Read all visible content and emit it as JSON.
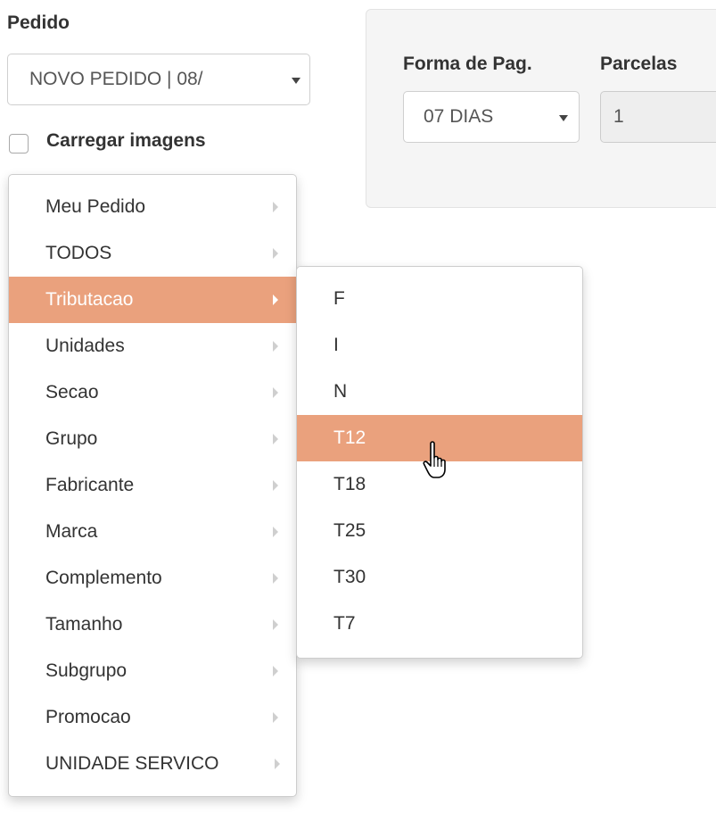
{
  "form": {
    "pedido_label": "Pedido",
    "pedido_value": "NOVO PEDIDO | 08/",
    "load_images_label": "Carregar imagens",
    "load_images_checked": false
  },
  "payment": {
    "forma_label": "Forma de Pag.",
    "forma_value": "07 DIAS",
    "parcelas_label": "Parcelas",
    "parcelas_value": "1"
  },
  "menu": {
    "items": [
      {
        "label": "Meu Pedido"
      },
      {
        "label": "TODOS"
      },
      {
        "label": "Tributacao",
        "active": true
      },
      {
        "label": "Unidades"
      },
      {
        "label": "Secao"
      },
      {
        "label": "Grupo"
      },
      {
        "label": "Fabricante"
      },
      {
        "label": "Marca"
      },
      {
        "label": "Complemento"
      },
      {
        "label": "Tamanho"
      },
      {
        "label": "Subgrupo"
      },
      {
        "label": "Promocao"
      },
      {
        "label": "UNIDADE SERVICO"
      }
    ]
  },
  "submenu": {
    "items": [
      {
        "label": "F"
      },
      {
        "label": "I"
      },
      {
        "label": "N"
      },
      {
        "label": "T12",
        "active": true
      },
      {
        "label": "T18"
      },
      {
        "label": "T25"
      },
      {
        "label": "T30"
      },
      {
        "label": "T7"
      }
    ]
  },
  "colors": {
    "active_bg": "#eaa17d",
    "panel_bg": "#f5f5f5"
  },
  "icons": {
    "cursor": "hand-pointer-icon",
    "submenu_arrow": "chevron-right-icon",
    "select_caret": "caret-down-icon"
  }
}
